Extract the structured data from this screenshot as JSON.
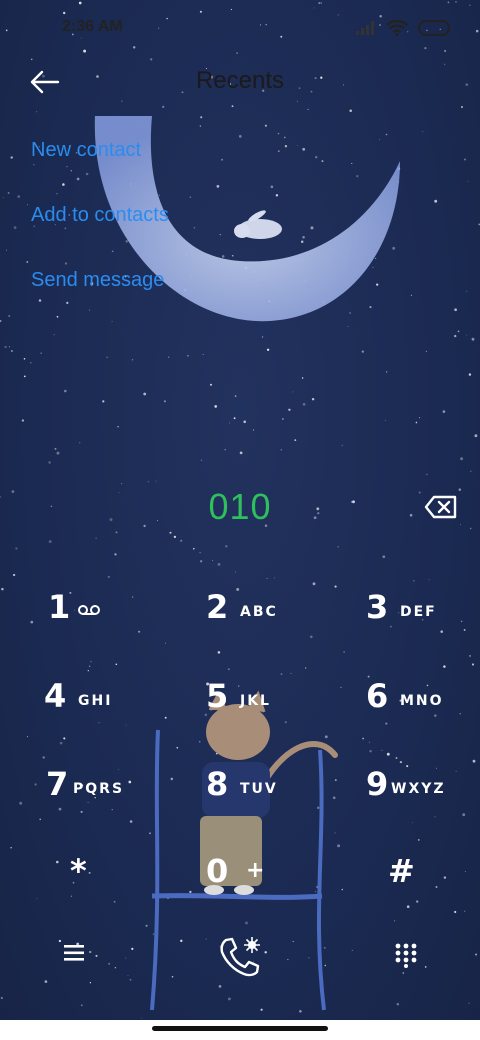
{
  "status_bar": {
    "time": "2:36 AM"
  },
  "header": {
    "title": "Recents"
  },
  "actions": [
    {
      "label": "New contact"
    },
    {
      "label": "Add to contacts"
    },
    {
      "label": "Send message"
    }
  ],
  "dialer": {
    "number": "010"
  },
  "keypad": [
    {
      "digit": "1",
      "letters": ""
    },
    {
      "digit": "2",
      "letters": "ABC"
    },
    {
      "digit": "3",
      "letters": "DEF"
    },
    {
      "digit": "4",
      "letters": "GHI"
    },
    {
      "digit": "5",
      "letters": "JKL"
    },
    {
      "digit": "6",
      "letters": "MNO"
    },
    {
      "digit": "7",
      "letters": "PQRS"
    },
    {
      "digit": "8",
      "letters": "TUV"
    },
    {
      "digit": "9",
      "letters": "WXYZ"
    },
    {
      "digit": "*",
      "letters": ""
    },
    {
      "digit": "0",
      "letters": "+"
    },
    {
      "digit": "#",
      "letters": ""
    }
  ],
  "colors": {
    "background": "#1b2a52",
    "accent": "#2b8cf0",
    "number": "#2fbf5c"
  },
  "icons": {
    "back": "arrow-left-icon",
    "backspace": "backspace-icon",
    "voicemail": "voicemail-icon",
    "menu": "menu-icon",
    "call": "call-icon",
    "keypad": "dialpad-icon"
  }
}
